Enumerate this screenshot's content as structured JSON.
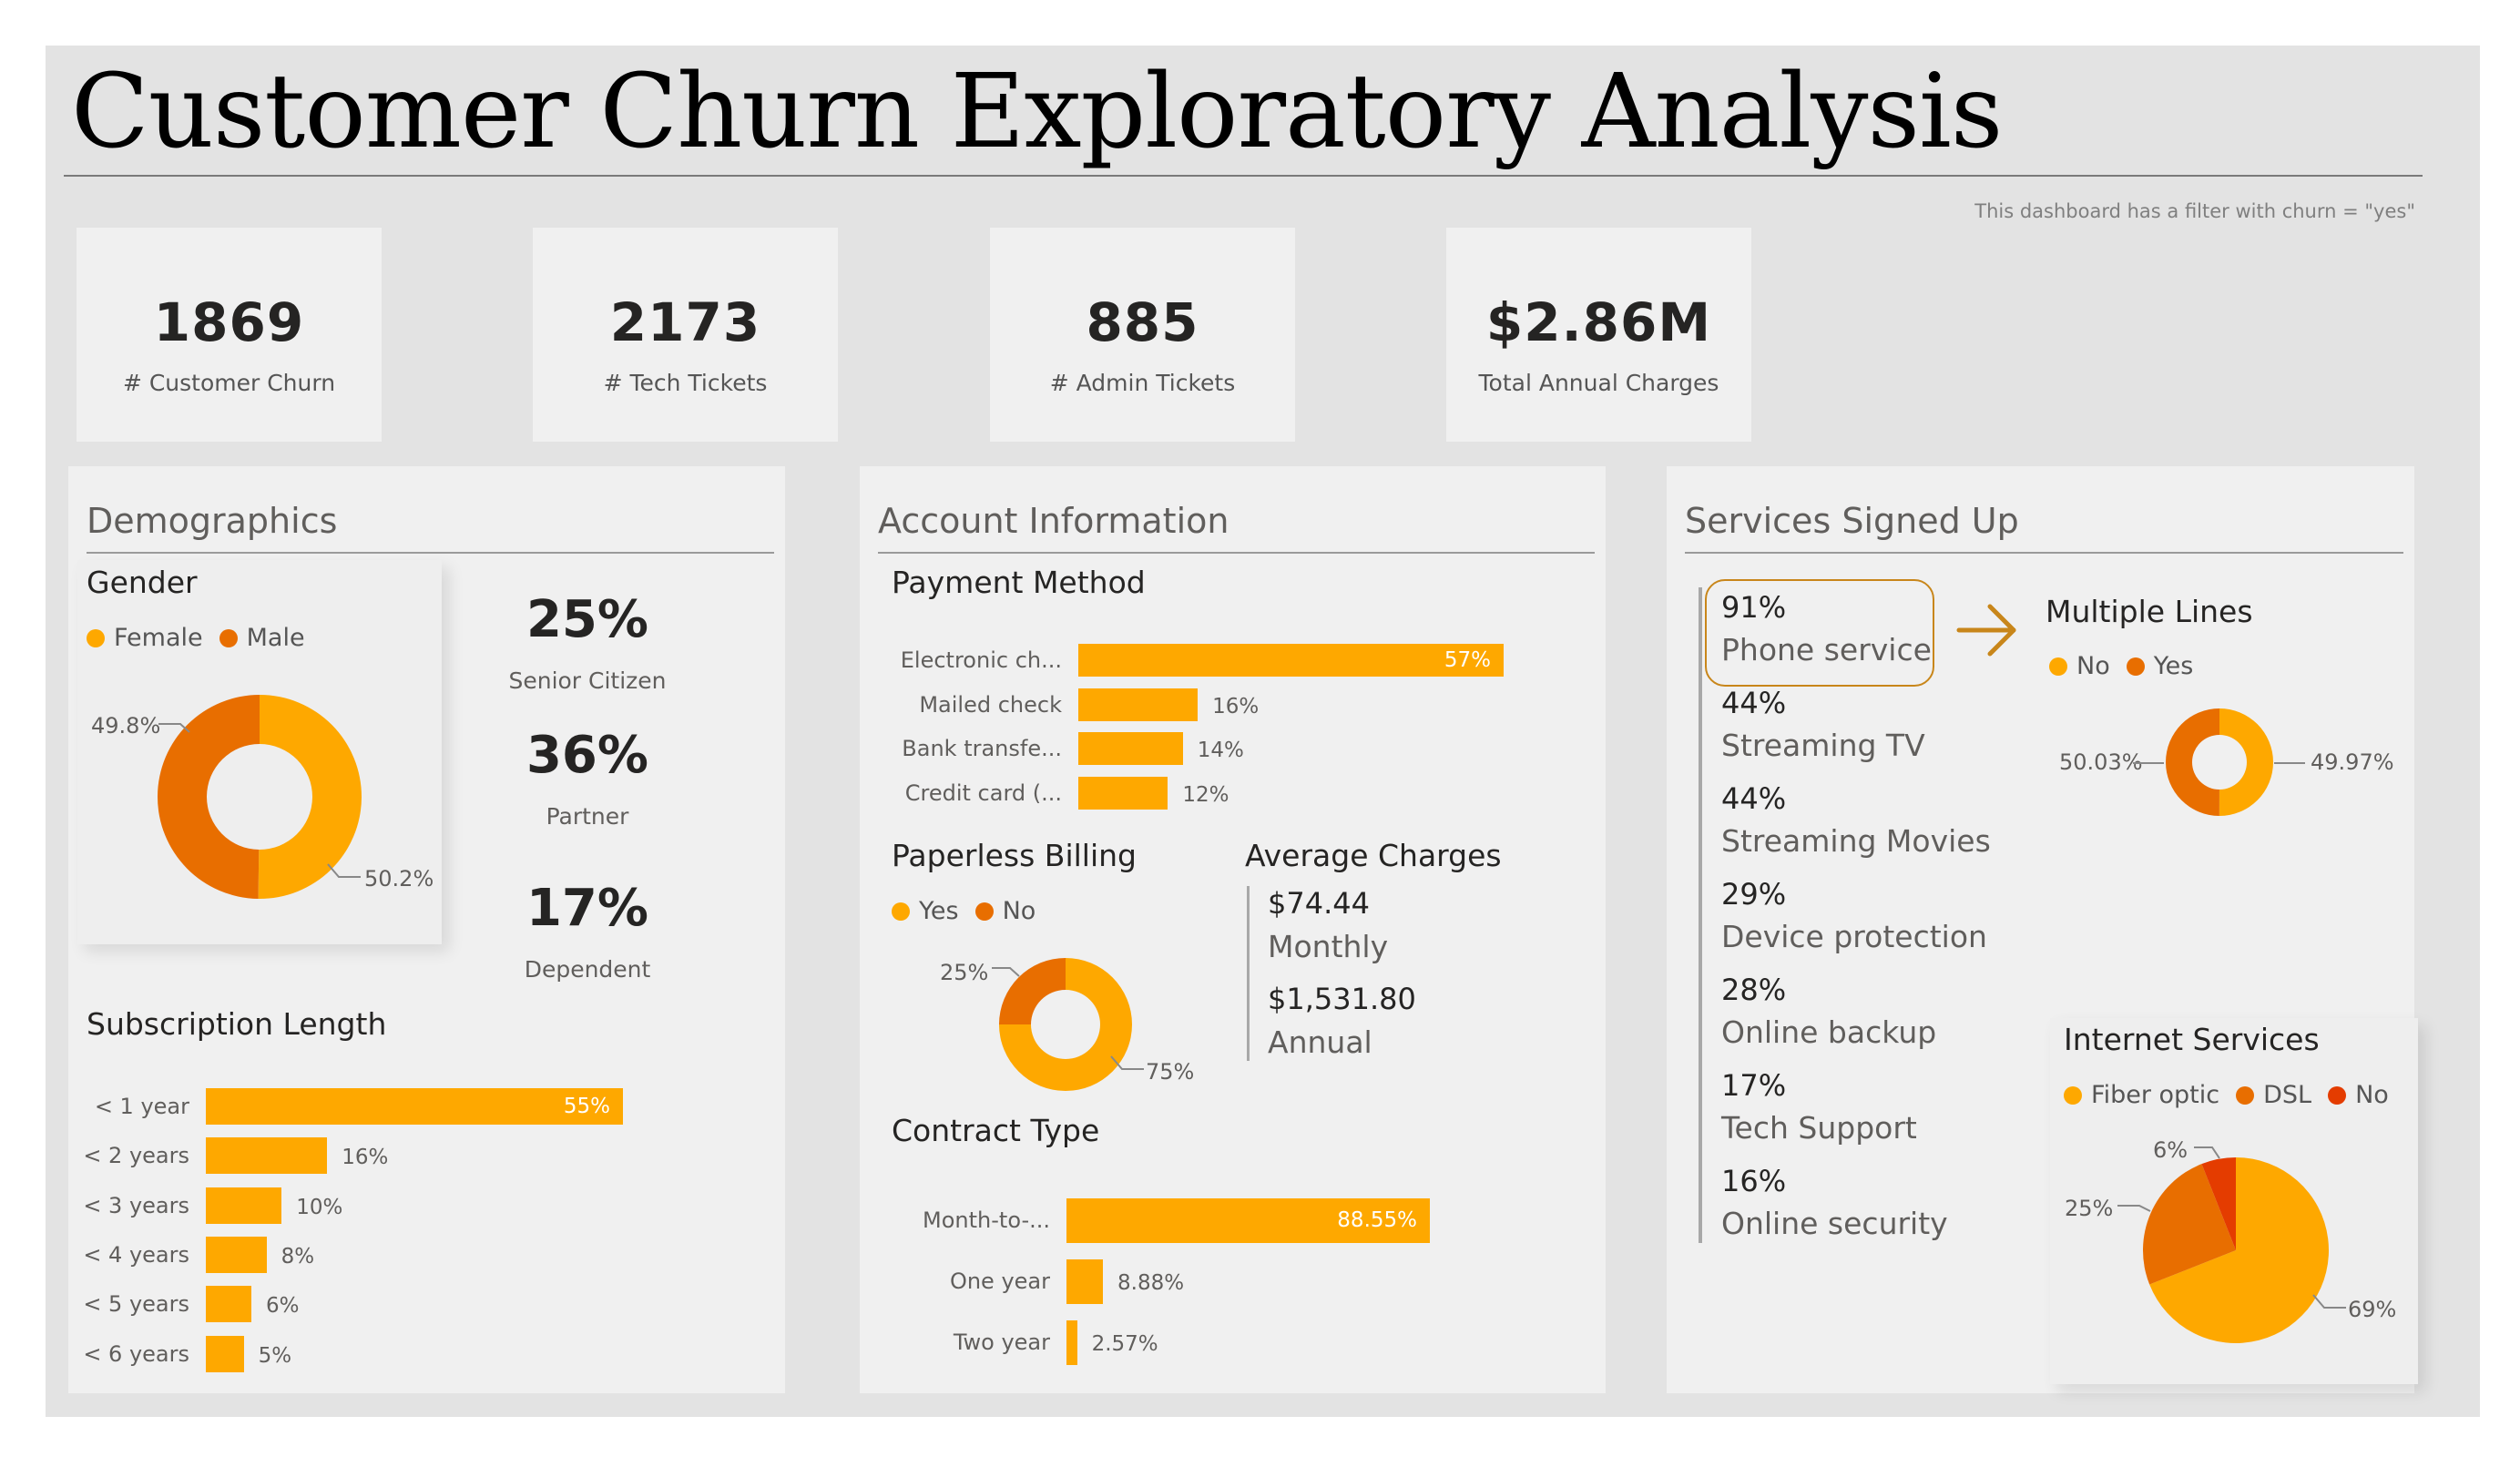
{
  "title": "Customer Churn Exploratory Analysis",
  "filter_note": "This dashboard has a filter with churn = \"yes\"",
  "colors": {
    "orange": "#fea800",
    "dark_orange": "#e86e00",
    "red": "#e43c00",
    "highlight_border": "#c8861a"
  },
  "kpis": [
    {
      "value": "1869",
      "label": "# Customer Churn"
    },
    {
      "value": "2173",
      "label": "# Tech Tickets"
    },
    {
      "value": "885",
      "label": "# Admin Tickets"
    },
    {
      "value": "$2.86M",
      "label": "Total Annual Charges"
    }
  ],
  "demographics": {
    "title": "Demographics",
    "gender": {
      "title": "Gender",
      "legend": [
        "Female",
        "Male"
      ],
      "female_label": "50.2%",
      "male_label": "49.8%"
    },
    "stats": [
      {
        "value": "25%",
        "label": "Senior Citizen"
      },
      {
        "value": "36%",
        "label": "Partner"
      },
      {
        "value": "17%",
        "label": "Dependent"
      }
    ],
    "subscription_title": "Subscription Length"
  },
  "account": {
    "title": "Account Information",
    "payment_title": "Payment Method",
    "paperless_title": "Paperless Billing",
    "paperless": {
      "legend": [
        "Yes",
        "No"
      ],
      "yes_label": "75%",
      "no_label": "25%"
    },
    "avg_title": "Average Charges",
    "avg_monthly_value": "$74.44",
    "avg_monthly_label": "Monthly",
    "avg_annual_value": "$1,531.80",
    "avg_annual_label": "Annual",
    "contract_title": "Contract Type"
  },
  "services": {
    "title": "Services Signed Up",
    "items": [
      {
        "pct": "91%",
        "label": "Phone service"
      },
      {
        "pct": "44%",
        "label": "Streaming TV"
      },
      {
        "pct": "44%",
        "label": "Streaming Movies"
      },
      {
        "pct": "29%",
        "label": "Device protection"
      },
      {
        "pct": "28%",
        "label": "Online backup"
      },
      {
        "pct": "17%",
        "label": "Tech Support"
      },
      {
        "pct": "16%",
        "label": "Online security"
      }
    ],
    "multiple_lines": {
      "title": "Multiple Lines",
      "legend": [
        "No",
        "Yes"
      ],
      "no_label": "50.03%",
      "yes_label": "49.97%"
    },
    "internet": {
      "title": "Internet Services",
      "legend": [
        "Fiber optic",
        "DSL",
        "No"
      ],
      "fiber_label": "69%",
      "dsl_label": "25%",
      "no_label": "6%"
    }
  },
  "chart_data": [
    {
      "type": "pie",
      "title": "Gender",
      "categories": [
        "Female",
        "Male"
      ],
      "values": [
        50.2,
        49.8
      ]
    },
    {
      "type": "bar",
      "title": "Subscription Length",
      "categories": [
        "< 1 year",
        "< 2 years",
        "< 3 years",
        "< 4 years",
        "< 5 years",
        "< 6 years"
      ],
      "values": [
        55,
        16,
        10,
        8,
        6,
        5
      ],
      "value_labels": [
        "55%",
        "16%",
        "10%",
        "8%",
        "6%",
        "5%"
      ],
      "inside_label": [
        true,
        false,
        false,
        false,
        false,
        false
      ]
    },
    {
      "type": "bar",
      "title": "Payment Method",
      "categories": [
        "Electronic ch...",
        "Mailed check",
        "Bank transfe...",
        "Credit card (..."
      ],
      "values": [
        57,
        16,
        14,
        12
      ],
      "value_labels": [
        "57%",
        "16%",
        "14%",
        "12%"
      ],
      "inside_label": [
        true,
        false,
        false,
        false
      ]
    },
    {
      "type": "pie",
      "title": "Paperless Billing",
      "categories": [
        "Yes",
        "No"
      ],
      "values": [
        75,
        25
      ]
    },
    {
      "type": "bar",
      "title": "Contract Type",
      "categories": [
        "Month-to-...",
        "One year",
        "Two year"
      ],
      "values": [
        88.55,
        8.88,
        2.57
      ],
      "value_labels": [
        "88.55%",
        "8.88%",
        "2.57%"
      ],
      "inside_label": [
        true,
        false,
        false
      ]
    },
    {
      "type": "pie",
      "title": "Multiple Lines",
      "categories": [
        "No",
        "Yes"
      ],
      "values": [
        50.03,
        49.97
      ]
    },
    {
      "type": "pie",
      "title": "Internet Services",
      "categories": [
        "Fiber optic",
        "DSL",
        "No"
      ],
      "values": [
        69,
        25,
        6
      ]
    }
  ]
}
